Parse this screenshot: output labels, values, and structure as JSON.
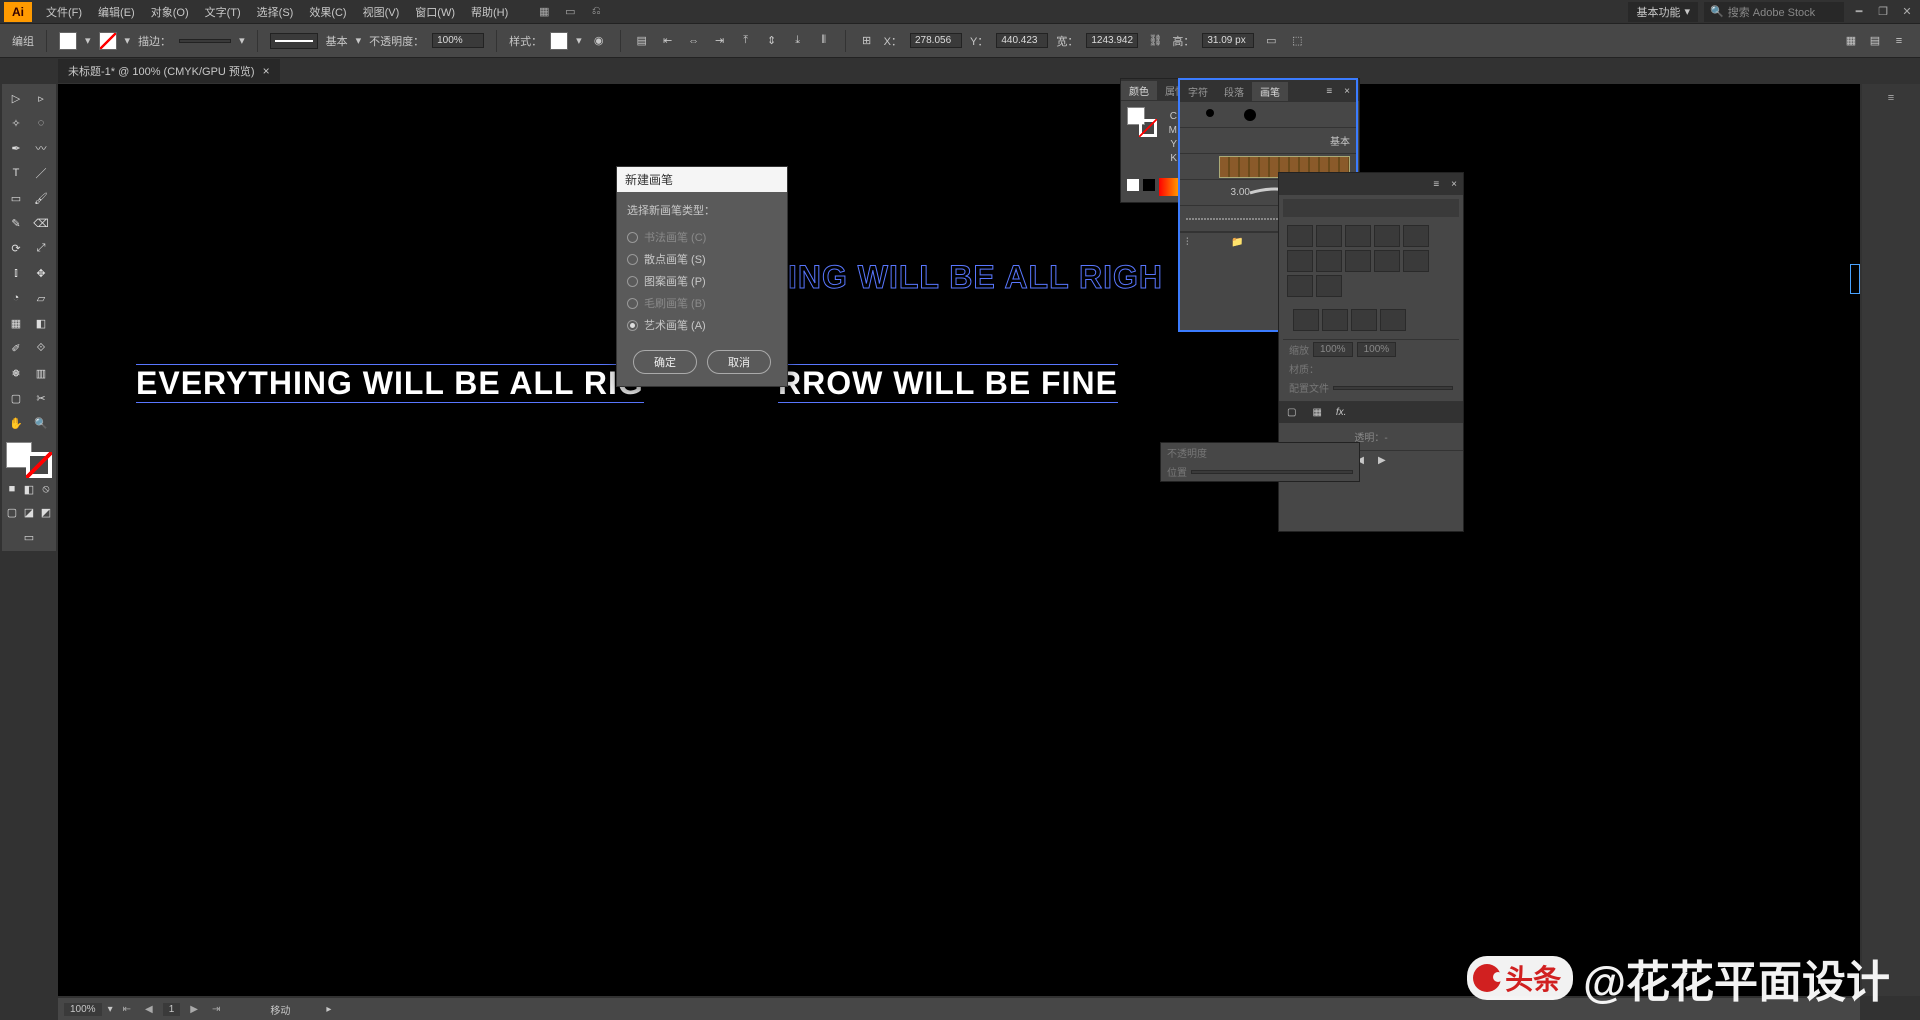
{
  "app_icon": "Ai",
  "menus": [
    "文件(F)",
    "编辑(E)",
    "对象(O)",
    "文字(T)",
    "选择(S)",
    "效果(C)",
    "视图(V)",
    "窗口(W)",
    "帮助(H)"
  ],
  "workspace_label": "基本功能",
  "search_placeholder": "搜索 Adobe Stock",
  "controlbar": {
    "group_label": "编组",
    "stroke_label": "描边：",
    "stroke_weight_dropdown": "▾",
    "brush_label": "基本",
    "opacity_label": "不透明度：",
    "opacity_value": "100%",
    "style_label": "样式：",
    "x_label": "X：",
    "x_value": "278.056",
    "y_label": "Y：",
    "y_value": "440.423",
    "w_label": "宽：",
    "w_value": "1243.942",
    "h_label": "高：",
    "h_value": "31.09 px"
  },
  "doc_tab": {
    "title": "未标题-1* @ 100% (CMYK/GPU 预览)",
    "close": "×"
  },
  "canvas": {
    "outline_text": "ING WILL BE ALL RIGH",
    "fill_text_left": "EVERYTHING WILL BE ALL RIG",
    "fill_text_right": "RROW WILL BE FINE"
  },
  "dialog": {
    "title": "新建画笔",
    "prompt": "选择新画笔类型：",
    "options": [
      {
        "label": "书法画笔 (C)",
        "enabled": false,
        "selected": false
      },
      {
        "label": "散点画笔 (S)",
        "enabled": true,
        "selected": false
      },
      {
        "label": "图案画笔 (P)",
        "enabled": true,
        "selected": false
      },
      {
        "label": "毛刷画笔 (B)",
        "enabled": false,
        "selected": false
      },
      {
        "label": "艺术画笔 (A)",
        "enabled": true,
        "selected": true
      }
    ],
    "ok": "确定",
    "cancel": "取消"
  },
  "panels": {
    "color_tabs": [
      "颜色",
      "属性"
    ],
    "brushes_tabs": [
      "字符",
      "段落",
      "画笔"
    ],
    "brush_basic_label": "基本",
    "brush_value": "3.00",
    "props_transparent_label": "透明：-",
    "stray_rows": [
      "不透明度",
      "位置"
    ]
  },
  "statusbar": {
    "zoom": "100%",
    "artboard_nav": "1",
    "tool_hint": "移动"
  },
  "watermark": {
    "badge": "头条",
    "text": "@花花平面设计"
  }
}
